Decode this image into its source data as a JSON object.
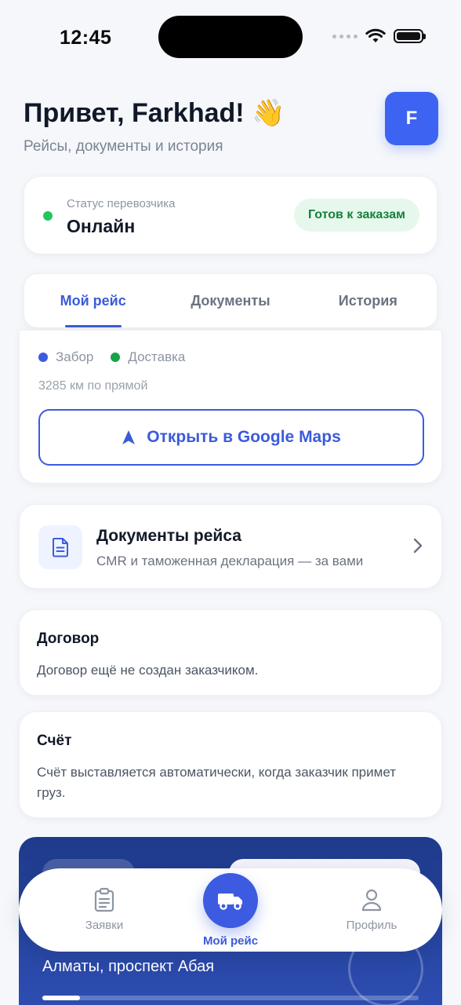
{
  "status_bar": {
    "time": "12:45"
  },
  "header": {
    "greeting": "Привет, Farkhad! 👋",
    "subtitle": "Рейсы, документы и история",
    "avatar_initial": "F"
  },
  "carrier_status": {
    "label": "Статус перевозчика",
    "value": "Онлайн",
    "badge": "Готов к заказам",
    "dot_color": "#22c55e"
  },
  "tabs": [
    {
      "label": "Мой рейс",
      "active": true
    },
    {
      "label": "Документы",
      "active": false
    },
    {
      "label": "История",
      "active": false
    }
  ],
  "route": {
    "legend_pickup": "Забор",
    "legend_delivery": "Доставка",
    "distance": "3285 км по прямой",
    "open_maps_label": "Открыть в Google Maps"
  },
  "trip_documents": {
    "title": "Документы рейса",
    "subtitle": "CMR и таможенная декларация — за вами"
  },
  "contract": {
    "title": "Договор",
    "text": "Договор ещё не создан заказчиком."
  },
  "invoice": {
    "title": "Счёт",
    "text": "Счёт выставляется автоматически, когда заказчик примет груз."
  },
  "trip_summary": {
    "address": "Алматы, проспект Абая",
    "progress_fraction": 0.1
  },
  "bottom_nav": {
    "orders_label": "Заявки",
    "my_trip_label": "Мой рейс",
    "profile_label": "Профиль"
  },
  "colors": {
    "accent": "#3d5be0",
    "online": "#22c55e",
    "badge_bg": "#e6f8ec",
    "badge_text": "#15803d"
  }
}
